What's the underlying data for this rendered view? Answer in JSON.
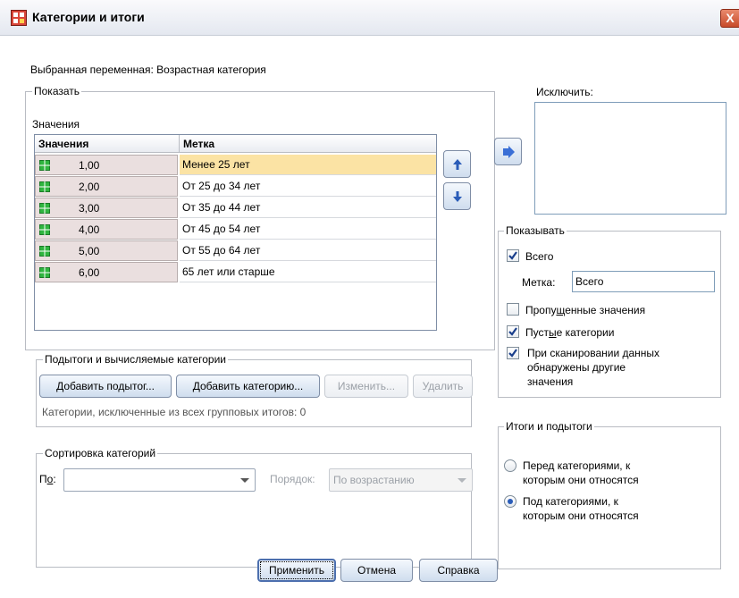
{
  "window": {
    "title": "Категории и итоги",
    "close_label": "X"
  },
  "selected_variable": "Выбранная переменная: Возрастная категория",
  "show_group": {
    "label": "Показать",
    "values_label": "Значения",
    "table": {
      "headers": [
        "Значения",
        "Метка"
      ],
      "rows": [
        {
          "value": "1,00",
          "label": "Менее 25 лет"
        },
        {
          "value": "2,00",
          "label": "От 25 до 34 лет"
        },
        {
          "value": "3,00",
          "label": "От 35 до 44 лет"
        },
        {
          "value": "4,00",
          "label": "От 45 до 54 лет"
        },
        {
          "value": "5,00",
          "label": "От 55 до 64 лет"
        },
        {
          "value": "6,00",
          "label": "65 лет или старше"
        }
      ]
    }
  },
  "subtotals": {
    "label": "Подытоги и вычисляемые категории",
    "add_subtotal": "Добавить подытог...",
    "add_category": "Добавить категорию...",
    "edit": "Изменить...",
    "delete": "Удалить",
    "note": "Категории, исключенные из всех групповых итогов: 0"
  },
  "sort": {
    "label": "Сортировка категорий",
    "by_prefix": "П",
    "by_mnemonic": "о",
    "by_suffix": ":",
    "by_value": "",
    "order_label": "Порядок:",
    "order_value": "По возрастанию"
  },
  "exclude": {
    "label": "Исключить:"
  },
  "display": {
    "label": "Показывать",
    "total": "Всего",
    "total_checked": true,
    "label_prefix": "Метка:",
    "label_value": "Всего",
    "missing_pre": "Пропу",
    "missing_mn": "щ",
    "missing_post": "енные значения",
    "missing_checked": false,
    "empty_pre": "Пуст",
    "empty_mn": "ы",
    "empty_post": "е категории",
    "empty_checked": true,
    "other_line1": "При сканировании данных",
    "other_line2": "обнаружены другие",
    "other_line3": "значения",
    "other_checked": true
  },
  "totals_position": {
    "label": "Итоги и подытоги",
    "before_line1": "Перед категориями, к",
    "before_line2": "которым они относятся",
    "after_line1": "Под категориями, к",
    "after_line2": "которым они относятся",
    "selected": "after"
  },
  "footer": {
    "apply": "Применить",
    "cancel": "Отмена",
    "help": "Справка"
  },
  "colors": {
    "selection": "#fbe3a4",
    "value_cell": "#eadfdf",
    "accent": "#2a5cb8"
  }
}
